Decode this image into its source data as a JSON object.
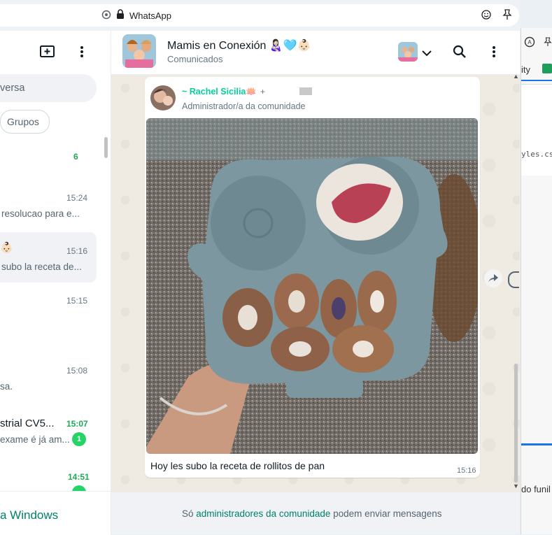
{
  "browser": {
    "tab_title": "WhatsApp"
  },
  "sidebar": {
    "search_placeholder": "versa",
    "filter_groups": "Grupos",
    "chats": [
      {
        "time": "",
        "preview": "",
        "badge": "6"
      },
      {
        "time": "15:24",
        "preview": "resolucao para e..."
      },
      {
        "time": "15:16",
        "preview": "subo la receta de..."
      },
      {
        "time": "15:15",
        "preview": ""
      },
      {
        "time": "15:08",
        "preview": "sa."
      },
      {
        "name": "strial CV5...",
        "time": "15:07",
        "preview": "exame é já am...",
        "badge": "1"
      },
      {
        "time": "14:51",
        "preview": ""
      }
    ],
    "footer_text": "a Windows"
  },
  "chat": {
    "name": "Mamis en Conexión",
    "name_emoji": "👩🏻‍🍼🩵👶🏻",
    "subtitle": "Comunicados",
    "message": {
      "sender": "~ Rachel Sicilia🪷",
      "sender_extra": "+",
      "role": "Administrador/a da comunidade",
      "caption": "Hoy les subo la receta de rollitos de pan",
      "time": "15:16"
    },
    "footer": {
      "prefix": "Só ",
      "link": "administradores da comunidade",
      "suffix": " podem enviar mensagens"
    }
  },
  "right_panel": {
    "frag1": "ity",
    "frag2": "yles.cs",
    "frag3": "do funil"
  },
  "colors": {
    "accent": "#008069",
    "sender": "#06cf9c",
    "badge": "#25d366",
    "chat_bg": "#efeae2"
  }
}
